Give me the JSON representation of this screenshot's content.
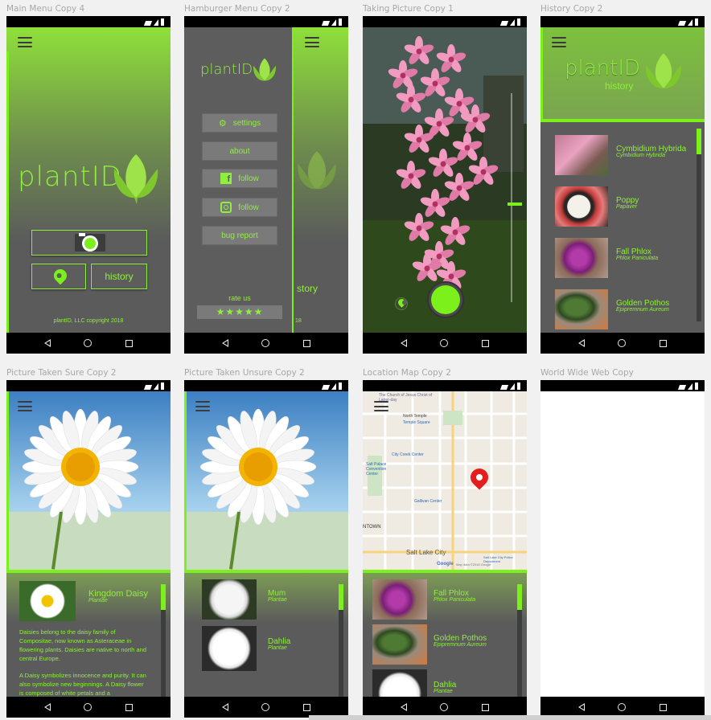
{
  "screens": {
    "main_menu": {
      "title": "Main Menu Copy 4",
      "logo_text": "plantID",
      "history_label": "history",
      "copyright": "plantID, LLC copyright 2018"
    },
    "hamburger": {
      "title": "Hamburger Menu Copy 2",
      "logo_text": "plantID",
      "items": [
        "settings",
        "about",
        "follow",
        "follow",
        "bug report"
      ],
      "rate_label": "rate us",
      "stars": "★★★★★",
      "peek_text": "story",
      "peek_year": "18"
    },
    "taking_picture": {
      "title": "Taking Picture Copy 1"
    },
    "history": {
      "title": "History Copy 2",
      "logo_text": "plantID",
      "subtitle": "history",
      "items": [
        {
          "name": "Cymbidium Hybrida",
          "sci": "Cymbidium Hybrida"
        },
        {
          "name": "Poppy",
          "sci": "Papaver"
        },
        {
          "name": "Fall Phlox",
          "sci": "Phlox Paniculata"
        },
        {
          "name": "Golden Pothos",
          "sci": "Epipremnum Aureum"
        }
      ]
    },
    "sure": {
      "title": "Picture Taken Sure Copy 2",
      "name": "Kingdom Daisy",
      "sci": "Plantae",
      "desc1": "Daisies belong to the daisy family of Compositae, now known as Asteraceae in flowering plants. Daisies are native to north and central Europe.",
      "desc2": "A Daisy symbolizes innocence and purity. It can also symbolize new beginnings. A Daisy flower is composed of white petals and a"
    },
    "unsure": {
      "title": "Picture Taken Unsure Copy 2",
      "items": [
        {
          "name": "Mum",
          "sci": "Plantae"
        },
        {
          "name": "Dahlia",
          "sci": "Plantae"
        }
      ]
    },
    "location": {
      "title": "Location Map Copy 2",
      "city_label": "Salt Lake City",
      "labels": [
        "The Church of Jesus Christ of Latter-day",
        "North Temple",
        "Temple Square",
        "City Creek Center",
        "Salt Palace Convention Center",
        "Gallivan Center",
        "NTOWN",
        "Salt Lake City Police Department",
        "Google",
        "Map data ©2018 Google"
      ],
      "items": [
        {
          "name": "Fall Phlox",
          "sci": "Phlox Paniculata"
        },
        {
          "name": "Golden Pothos",
          "sci": "Epipremnum Aureum"
        },
        {
          "name": "Dahlia",
          "sci": "Plantae"
        }
      ]
    },
    "www": {
      "title": "World Wide Web Copy"
    }
  },
  "colors": {
    "accent": "#7cf01a",
    "panel": "#5b5b5b",
    "text_green": "#8ef03a"
  }
}
